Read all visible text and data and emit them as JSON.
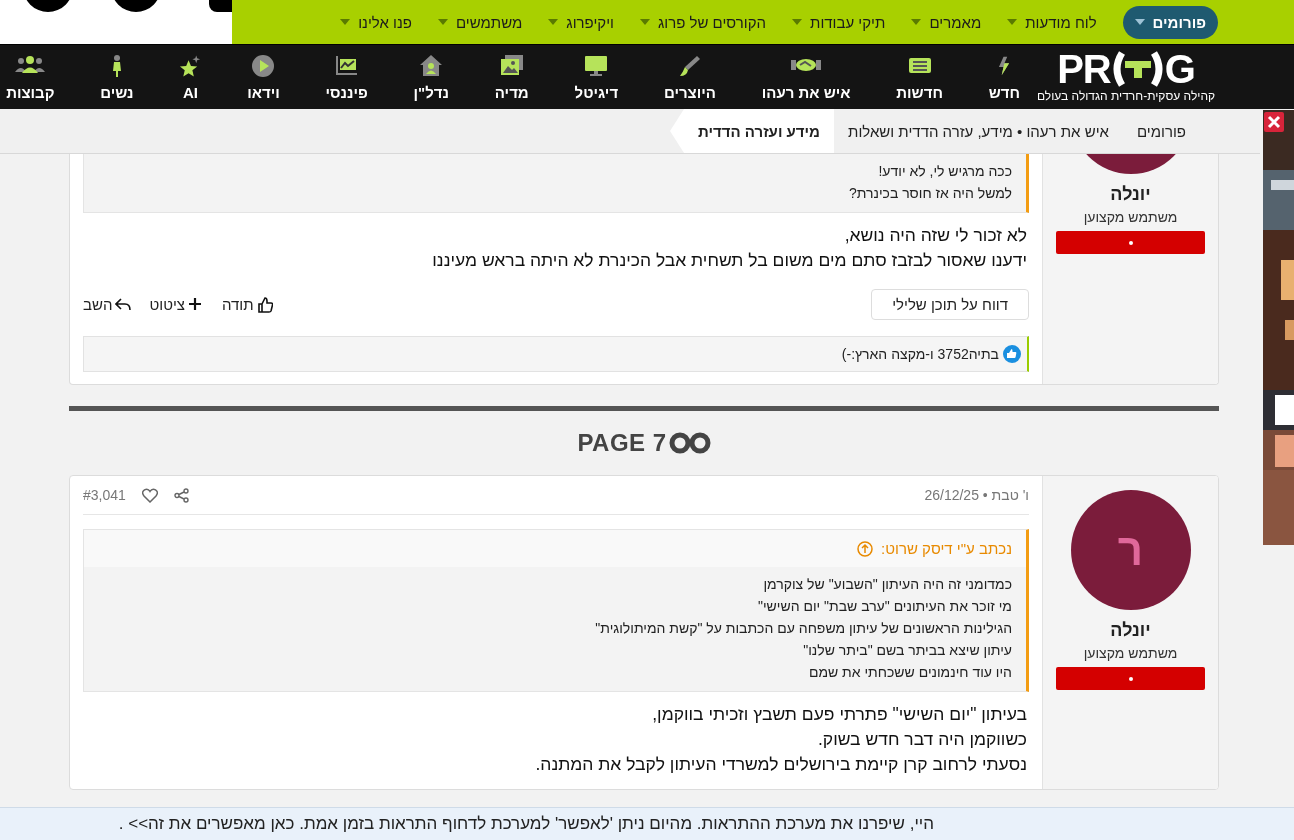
{
  "top_nav": {
    "items": [
      {
        "label": "פורומים",
        "selected": true
      },
      {
        "label": "לוח מודעות",
        "selected": false
      },
      {
        "label": "מאמרים",
        "selected": false
      },
      {
        "label": "תיקי עבודות",
        "selected": false
      },
      {
        "label": "הקורסים של פרוג",
        "selected": false
      },
      {
        "label": "ויקיפרוג",
        "selected": false
      },
      {
        "label": "משתמשים",
        "selected": false
      },
      {
        "label": "פנו אלינו",
        "selected": false
      }
    ]
  },
  "logo": {
    "start": "PR",
    "end": "G",
    "tagline": "קהילה עסקית-חרדית הגדולה בעולם"
  },
  "category_nav": {
    "items": [
      {
        "label": "חדש"
      },
      {
        "label": "חדשות"
      },
      {
        "label": "איש את רעהו"
      },
      {
        "label": "היוצרים"
      },
      {
        "label": "דיגיטל"
      },
      {
        "label": "מדיה"
      },
      {
        "label": "נדל\"ן"
      },
      {
        "label": "פיננסי"
      },
      {
        "label": "וידאו"
      },
      {
        "label": "AI"
      },
      {
        "label": "נשים"
      },
      {
        "label": "קבוצות"
      }
    ]
  },
  "breadcrumb": [
    {
      "label": "פורומים",
      "current": false
    },
    {
      "label": "איש את רעהו • מידע, עזרה הדדית ושאלות",
      "current": false
    },
    {
      "label": "מידע ועזרה הדדית",
      "current": true
    }
  ],
  "posts": [
    {
      "author": "יונלה",
      "role": "משתמש מקצוען",
      "quote_lines": [
        "ככה מרגיש לי, לא יודע!",
        "למשל היה אז חוסר בכינרת?"
      ],
      "body_lines": [
        "לא זכור לי שזה היה נושא,",
        "ידענו שאסור לבזבז סתם מים משום בל תשחית אבל הכינרת לא היתה בראש מעיננו"
      ],
      "report_button": "דווח על תוכן שלילי",
      "actions": [
        {
          "label": "תודה"
        },
        {
          "label": "ציטוט"
        },
        {
          "label": "השב"
        }
      ],
      "likes": "בתיה3752 ו-מקצה הארץ:-)"
    },
    {
      "author": "יונלה",
      "role": "משתמש מקצוען",
      "avatar_letter": "ר",
      "date": "ו' טבת • 26/12/25",
      "number": "#3,041",
      "quote_author": "נכתב ע\"י דיסק שרוט:",
      "quote_lines": [
        "כמדומני זה היה העיתון \"השבוע\" של צוקרמן",
        "מי זוכר את העיתונים \"ערב שבת\" יום השישי\"",
        "הגילינות הראשונים של עיתון משפחה עם הכתבות על \"קשת המיתולוגית\"",
        "עיתון שיצא בביתר בשם \"ביתר שלנו\"",
        "היו עוד חינמונים ששכחתי את שמם"
      ],
      "body_lines": [
        "בעיתון \"יום השישי\" פתרתי פעם תשבץ וזכיתי בווקמן,",
        "כשווקמן היה דבר חדש בשוק.",
        "נסעתי לרחוב קרן קיימת בירושלים למשרדי העיתון לקבל את המתנה."
      ]
    }
  ],
  "page_marker": "PAGE 7",
  "notice": {
    "text": "היי, שיפרנו את מערכת ההתראות. מהיום ניתן 'לאפשר' למערכת לדחוף התראות בזמן אמת.",
    "link": "כאן מאפשרים את זה>>",
    "tail": " ."
  }
}
